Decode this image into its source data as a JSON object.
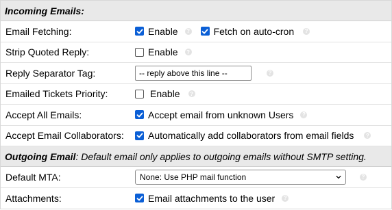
{
  "sections": {
    "incoming_title": "Incoming Emails:",
    "outgoing_title": "Outgoing Email",
    "outgoing_note": ": Default email only applies to outgoing emails without SMTP setting."
  },
  "rows": {
    "email_fetching": {
      "label": "Email Fetching:",
      "enable_label": "Enable",
      "enable_checked": true,
      "cron_label": "Fetch on auto-cron",
      "cron_checked": true
    },
    "strip_quoted": {
      "label": "Strip Quoted Reply:",
      "enable_label": "Enable",
      "enable_checked": false
    },
    "reply_separator": {
      "label": "Reply Separator Tag:",
      "value": "-- reply above this line --"
    },
    "tickets_priority": {
      "label": "Emailed Tickets Priority:",
      "enable_label": "Enable",
      "enable_checked": false
    },
    "accept_all": {
      "label": "Accept All Emails:",
      "option_label": "Accept email from unknown Users",
      "checked": true
    },
    "accept_collab": {
      "label": "Accept Email Collaborators:",
      "option_label": "Automatically add collaborators from email fields",
      "checked": true
    },
    "default_mta": {
      "label": "Default MTA:",
      "selected": "None: Use PHP mail function"
    },
    "attachments": {
      "label": "Attachments:",
      "option_label": "Email attachments to the user",
      "checked": true
    }
  },
  "colors": {
    "checkbox_checked": "#0b5fd6",
    "header_bg": "#e9e9e9",
    "help_icon": "#e3e3e3"
  },
  "icons": {
    "help": "question-circle-icon",
    "check": "checkmark-icon",
    "dropdown": "chevron-down-icon"
  }
}
